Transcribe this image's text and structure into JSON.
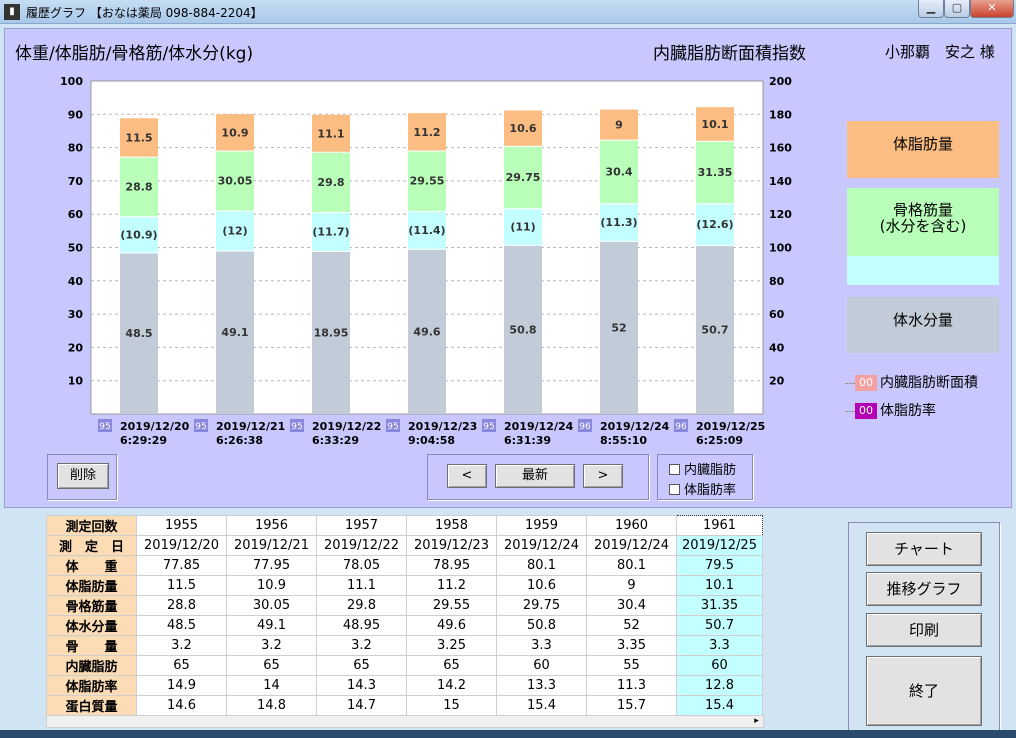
{
  "window": {
    "title": "履歴グラフ 【おなは薬局 098-884-2204】",
    "icon": "app-icon"
  },
  "header": {
    "left": "体重/体脂肪/骨格筋/体水分(kg)",
    "mid": "内臓脂肪断面積指数",
    "patient": "小那覇　安之 様"
  },
  "chart_data": {
    "type": "bar",
    "stacked": true,
    "categories": [
      "2019/12/20 6:29:29",
      "2019/12/21 6:26:38",
      "2019/12/22 6:33:29",
      "2019/12/23 9:04:58",
      "2019/12/24 6:31:39",
      "2019/12/24 8:55:10",
      "2019/12/25 6:25:09"
    ],
    "x_badges": [
      "95",
      "95",
      "95",
      "95",
      "95",
      "96",
      "96"
    ],
    "ylim": [
      0,
      100
    ],
    "y2lim": [
      0,
      200
    ],
    "yticks": [
      "100",
      "90",
      "80",
      "70",
      "60",
      "50",
      "40",
      "30",
      "20",
      "10"
    ],
    "y2ticks": [
      "200",
      "180",
      "160",
      "140",
      "120",
      "100",
      "80",
      "60",
      "40",
      "20"
    ],
    "series": [
      {
        "name": "体水分量",
        "color": "#c2ccd8",
        "values": [
          48.5,
          49.1,
          48.95,
          49.6,
          50.8,
          52,
          50.7
        ],
        "labels": [
          "48.5",
          "49.1",
          "18.95",
          "49.6",
          "50.8",
          "52",
          "50.7"
        ]
      },
      {
        "name": "(水分を含む)",
        "color": "#c3ffff",
        "values": [
          10.9,
          12,
          11.7,
          11.4,
          11,
          11.3,
          12.6
        ],
        "labels": [
          "(10.9)",
          "(12)",
          "(11.7)",
          "(11.4)",
          "(11)",
          "(11.3)",
          "(12.6)"
        ]
      },
      {
        "name": "骨格筋量",
        "color": "#b9ffb9",
        "values": [
          17.9,
          18.05,
          18.1,
          18.15,
          18.75,
          19.1,
          18.75
        ],
        "labels": [
          "28.8",
          "30.05",
          "29.8",
          "29.55",
          "29.75",
          "30.4",
          "31.35"
        ]
      },
      {
        "name": "体脂肪量",
        "color": "#fbbd82",
        "values": [
          11.5,
          10.9,
          11.1,
          11.2,
          10.6,
          9,
          10.1
        ],
        "labels": [
          "11.5",
          "10.9",
          "11.1",
          "11.2",
          "10.6",
          "9",
          "10.1"
        ]
      }
    ],
    "grid": true
  },
  "legend": {
    "fat": "体脂肪量",
    "muscle_line1": "骨格筋量",
    "muscle_line2": "(水分を含む)",
    "water": "体水分量",
    "visceral_swatch": "00",
    "visceral_label": "内臓脂肪断面積",
    "visceral_color": "#f4a0a0",
    "bodyfat_swatch": "00",
    "bodyfat_label": "体脂肪率",
    "bodyfat_color": "#b400b4"
  },
  "controls": {
    "delete": "削除",
    "prev": "<",
    "latest": "最新",
    "next": ">",
    "chk_visceral": "内臓脂肪",
    "chk_bodyfat": "体脂肪率"
  },
  "table": {
    "row_headers": [
      "測定回数",
      "測　定　日",
      "体　　重",
      "体脂肪量",
      "骨格筋量",
      "体水分量",
      "骨　　量",
      "内臓脂肪",
      "体脂肪率",
      "蛋白質量"
    ],
    "columns": [
      [
        "1955",
        "2019/12/20",
        "77.85",
        "11.5",
        "28.8",
        "48.5",
        "3.2",
        "65",
        "14.9",
        "14.6"
      ],
      [
        "1956",
        "2019/12/21",
        "77.95",
        "10.9",
        "30.05",
        "49.1",
        "3.2",
        "65",
        "14",
        "14.8"
      ],
      [
        "1957",
        "2019/12/22",
        "78.05",
        "11.1",
        "29.8",
        "48.95",
        "3.2",
        "65",
        "14.3",
        "14.7"
      ],
      [
        "1958",
        "2019/12/23",
        "78.95",
        "11.2",
        "29.55",
        "49.6",
        "3.25",
        "65",
        "14.2",
        "15"
      ],
      [
        "1959",
        "2019/12/24",
        "80.1",
        "10.6",
        "29.75",
        "50.8",
        "3.3",
        "60",
        "13.3",
        "15.4"
      ],
      [
        "1960",
        "2019/12/24",
        "80.1",
        "9",
        "30.4",
        "52",
        "3.35",
        "55",
        "11.3",
        "15.7"
      ],
      [
        "1961",
        "2019/12/25",
        "79.5",
        "10.1",
        "31.35",
        "50.7",
        "3.3",
        "60",
        "12.8",
        "15.4"
      ]
    ]
  },
  "side_buttons": {
    "chart": "チャート",
    "trend": "推移グラフ",
    "print": "印刷",
    "exit": "終了"
  }
}
